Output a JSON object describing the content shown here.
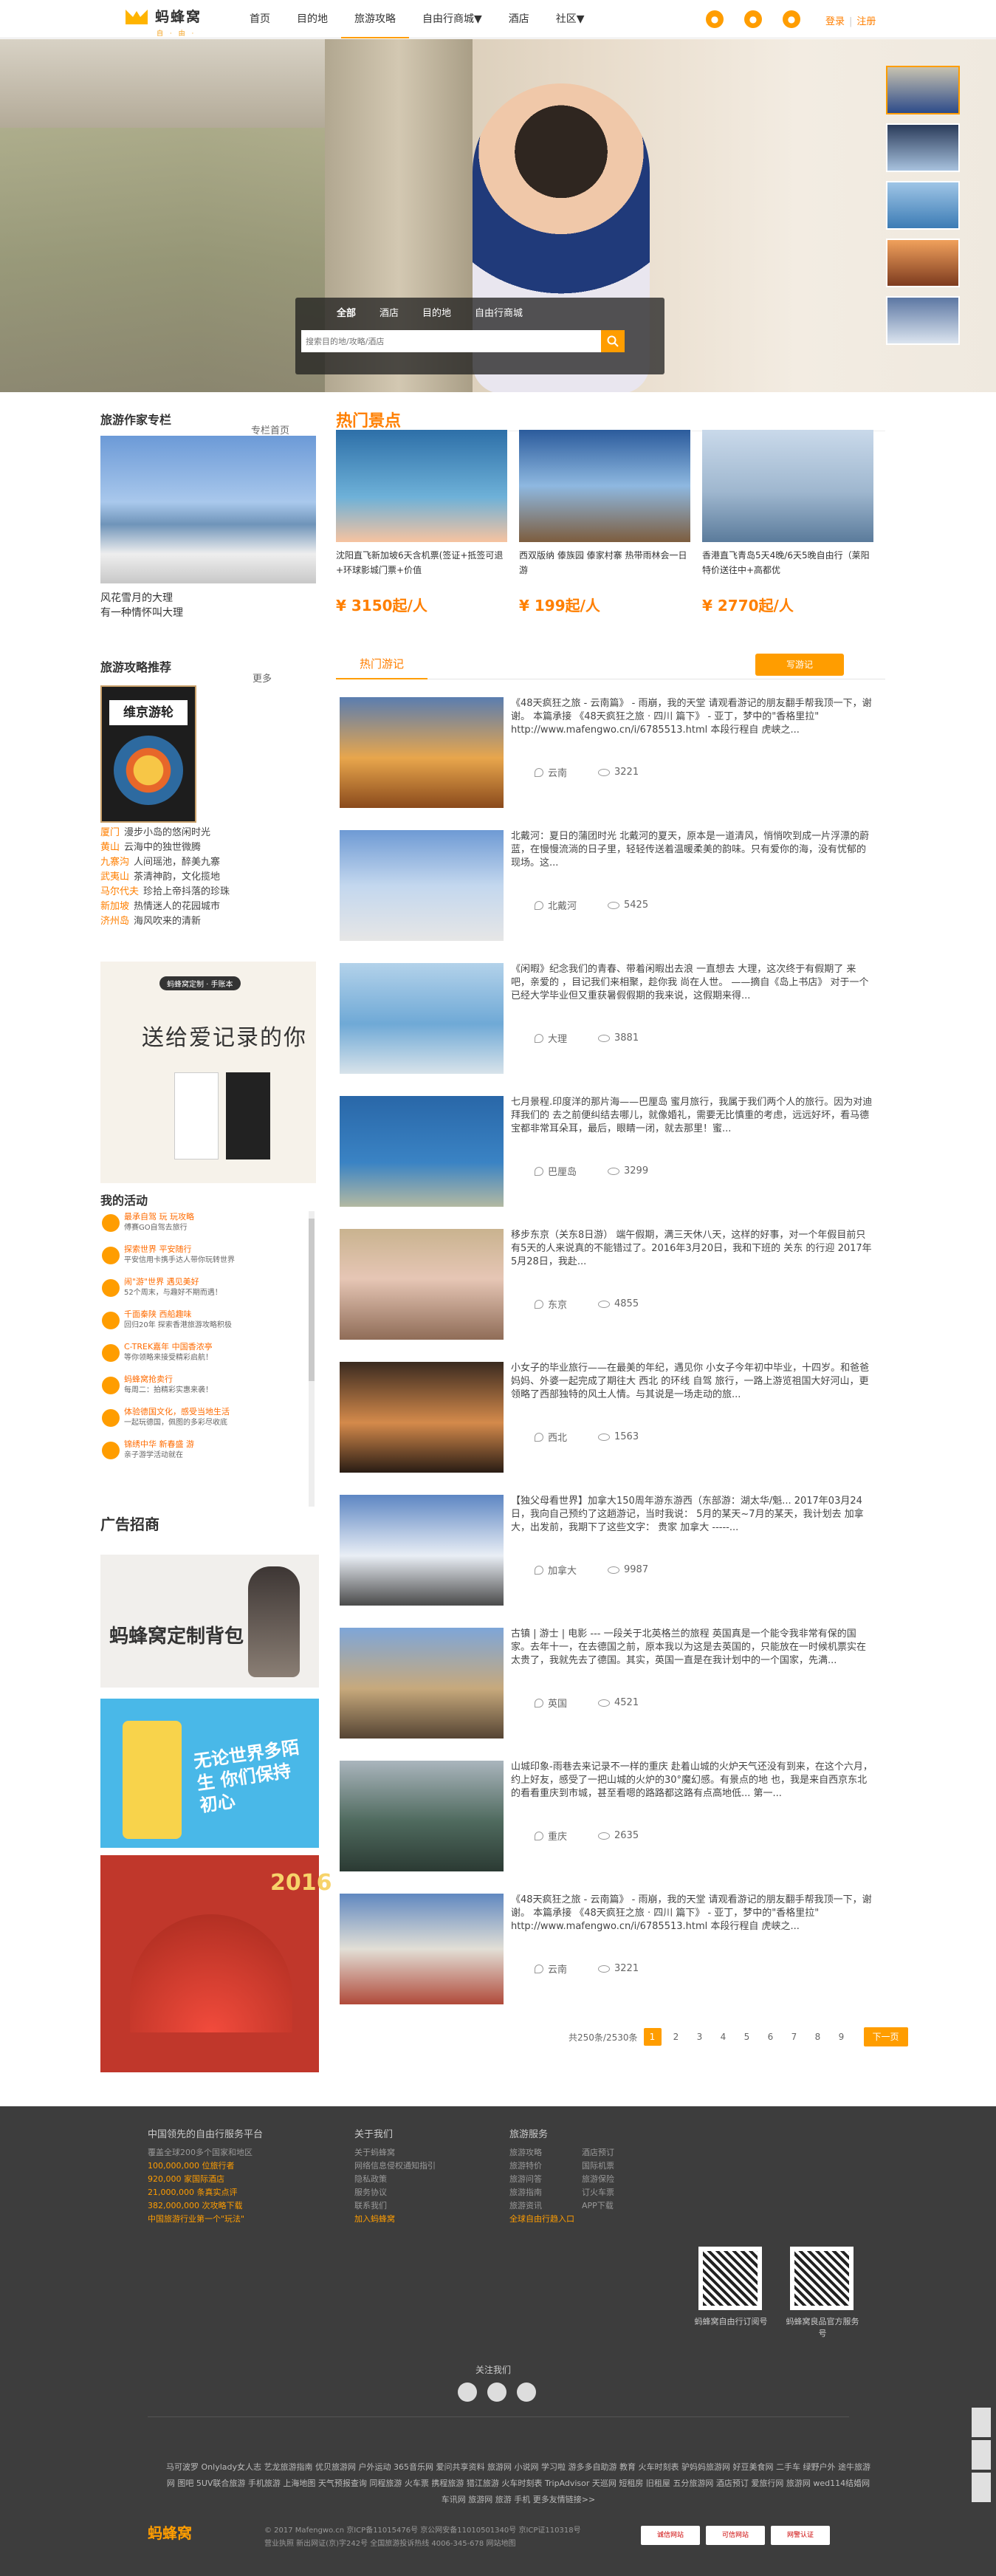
{
  "header": {
    "brand": "蚂蜂窝",
    "brand_sub": "自 · 由 · 行",
    "nav": [
      "首页",
      "目的地",
      "旅游攻略",
      "自由行商城▼",
      "酒店",
      "社区▼"
    ],
    "login": "登录",
    "register": "注册"
  },
  "search": {
    "tabs": [
      "全部",
      "酒店",
      "目的地",
      "自由行商城"
    ],
    "placeholder": "搜索目的地/攻略/酒店"
  },
  "columnist": {
    "title": "旅游作家专栏",
    "more": "专栏首页",
    "caption_1": "风花雪月的大理",
    "caption_2": "有一种情怀叫大理"
  },
  "guides": {
    "title": "旅游攻略推荐",
    "more": "更多",
    "book_title": "维京游轮",
    "items": [
      {
        "k": "厦门",
        "v": "漫步小岛的悠闲时光"
      },
      {
        "k": "黄山",
        "v": "云海中的独世微腾"
      },
      {
        "k": "九寨沟",
        "v": "人间瑶池，醉美九寨"
      },
      {
        "k": "武夷山",
        "v": "茶清神韵，文化揽地"
      },
      {
        "k": "马尔代夫",
        "v": "珍拾上帝抖落的珍珠"
      },
      {
        "k": "新加坡",
        "v": "热情迷人的花园城市"
      },
      {
        "k": "济州岛",
        "v": "海风吹来的清新"
      }
    ]
  },
  "promo": {
    "tag": "蚂蜂窝定制 · 手账本",
    "headline": "送给爱记录的你"
  },
  "activities": {
    "title": "我的活动",
    "items": [
      {
        "t": "最承自驾 玩 玩攻略",
        "s": "傅赛GO自驾去旅行"
      },
      {
        "t": "探索世界 平安随行",
        "s": "平安信用卡携手达人带你玩转世界"
      },
      {
        "t": "闹\"游\"世界 遇见美好",
        "s": "52个周末，与趣好不期而遇！"
      },
      {
        "t": "千面秦陕 西船趣味",
        "s": "回归20年 探索香港旅游攻略积极"
      },
      {
        "t": "C-TREK嘉年 中国香浓亭",
        "s": "等你领略来接受精彩启航！"
      },
      {
        "t": "蚂蜂窝抢卖行",
        "s": "每周二：拍精彩实惠来袭！"
      },
      {
        "t": "体验德国文化，感受当地生活",
        "s": "一起玩德国，佩图的多彩尽收底"
      },
      {
        "t": "锦绣中华 新春盛 游",
        "s": "亲子游学活动就在"
      }
    ]
  },
  "ads": {
    "title": "广告招商",
    "bag_text": "蚂蜂窝定制背包",
    "luggage_text": "无论世界多陌生 你们保持初心",
    "year": "2016"
  },
  "hot": {
    "title": "热门景点",
    "spots": [
      {
        "desc": "沈阳直飞新加坡6天含机票(签证+抵签可退+环球影城门票+价值",
        "price": "¥ 3150起/人"
      },
      {
        "desc": "西双版纳 傣族园 傣家村寨 热带雨林会一日游",
        "price": "¥ 199起/人"
      },
      {
        "desc": "香港直飞青岛5天4晚/6天5晚自由行（莱阳特价送往中+高都优",
        "price": "¥ 2770起/人"
      }
    ]
  },
  "notes": {
    "tab": "热门游记",
    "write": "写游记",
    "items": [
      {
        "text": "《48天疯狂之旅 - 云南篇》 - 雨崩，我的天堂 请观看游记的朋友翻手帮我顶一下，谢谢。 本篇承接 《48天疯狂之旅 · 四川 篇下》 - 亚丁，梦中的\"香格里拉\" http://www.mafengwo.cn/i/6785513.html 本段行程自 虎峡之...",
        "loc": "云南",
        "views": "3221"
      },
      {
        "text": "北戴河：夏日的蒲团时光 北戴河的夏天，原本是一道清风，悄悄吹到成一片浮漂的蔚蓝，在慢慢流淌的日子里，轻轻传送着温暖柔美的韵味。只有爱你的海，没有忧郁的现场。这...",
        "loc": "北戴河",
        "views": "5425"
      },
      {
        "text": "《闲暇》纪念我们的青春、带着闲暇出去浪 一直想去 大理，这次终于有假期了 来吧，亲爱的 ，目记我们来相聚，趁你我 尚在人世。 ——摘自《岛上书店》 对于一个已经大学毕业但又重获暑假假期的我来说，这假期来得...",
        "loc": "大理",
        "views": "3881"
      },
      {
        "text": "七月景程.印度洋的那片海——巴厘岛 蜜月旅行，我属于我们两个人的旅行。因为对迪拜我们的 去之前便纠结去哪儿，就像婚礼，需要无比慎重的考虑，远远好坏，看马德宝都非常耳朵耳，最后，眼睛一闭，就去那里！蜜...",
        "loc": "巴厘岛",
        "views": "3299"
      },
      {
        "text": "移步东京（关东8日游） 端午假期，满三天休八天，这样的好事，对一个年假目前只有5天的人来说真的不能错过了。2016年3月20日，我和下班的 关东 的行迎 2017年5月28日，我赴...",
        "loc": "东京",
        "views": "4855"
      },
      {
        "text": "小女子的毕业旅行——在最美的年纪，遇见你 小女子今年初中毕业，十四岁。和爸爸妈妈、外婆一起完成了期往大 西北 的环线 自驾 旅行，一路上游览祖国大好河山，更领略了西部独特的风土人情。与其说是一场走动的旅... ",
        "loc": "西北",
        "views": "1563"
      },
      {
        "text": "【独父母看世界】加拿大150周年游东游西（东部游：湖太华/魁... 2017年03月24日，我向自己预约了这趟游记，当时我说： 5月的某天~7月的某天，我计划去 加拿大，出发前，我期下了这些文字： 贵家 加拿大 -----...",
        "loc": "加拿大",
        "views": "9987"
      },
      {
        "text": "古镇 | 游士 | 电影 --- 一段关于北英格兰的旅程 英国真是一个能令我非常有保的国家。去年十一，在去德国之前，原本我以为这是去英国的，只能放在一时候机票实在太贵了，我就先去了德国。其实，英国一直是在我计划中的一个国家，先满...",
        "loc": "英国",
        "views": "4521"
      },
      {
        "text": "山城印象-雨巷去来记录不一样的重庆 赴着山城的火炉天气还没有到来，在这个六月，约上好友，感受了一把山城的火炉的30°魔幻感。有景点的地 也，我是来自西京东北的看看重庆到市城，甚至看嗯的路路都这路有点高地低... 第一...",
        "loc": "重庆",
        "views": "2635"
      },
      {
        "text": "《48天疯狂之旅 - 云南篇》 - 雨崩，我的天堂 请观看游记的朋友翻手帮我顶一下，谢谢。 本篇承接 《48天疯狂之旅 · 四川 篇下》 - 亚丁，梦中的\"香格里拉\" http://www.mafengwo.cn/i/6785513.html 本段行程自 虎峡之...",
        "loc": "云南",
        "views": "3221"
      }
    ]
  },
  "pager": {
    "total": "共250条/2530条",
    "pages": [
      "1",
      "2",
      "3",
      "4",
      "5",
      "6",
      "7",
      "8",
      "9"
    ],
    "next": "下一页"
  },
  "footer": {
    "about_title": "中国领先的自由行服务平台",
    "about_lines": [
      "覆盖全球200多个国家和地区",
      "100,000,000 位旅行者",
      "920,000 家国际酒店",
      "21,000,000 条真实点评",
      "382,000,000 次攻略下载",
      "中国旅游行业第一个\"玩法\""
    ],
    "us_title": "关于我们",
    "us_links": [
      "关于蚂蜂窝",
      "网络信息侵权通知指引",
      "隐私政策",
      "服务协议",
      "联系我们",
      "加入蚂蜂窝"
    ],
    "svc_title": "旅游服务",
    "svc_links_a": [
      "旅游攻略",
      "旅游特价",
      "旅游问答",
      "旅游指南",
      "旅游资讯",
      "全球自由行趋入口"
    ],
    "svc_links_b": [
      "酒店预订",
      "国际机票",
      "旅游保险",
      "订火车票",
      "APP下载"
    ],
    "qr1": "蚂蜂窝自由行订阅号",
    "qr2": "蚂蜂窝良品官方服务号",
    "follow": "关注我们",
    "links": "马可波罗 Onlylady女人志 艺龙旅游指南 优贝旅游网 户外运动 365音乐网 爱问共享资料 旅游网 小说网 学习啦 游多多自助游 教育 火车时刻表 驴妈妈旅游网 好豆美食网 二手车 绿野户外 途牛旅游网 图吧 5UV联合旅游 手机旅游 上海地图 天气预报查询 同程旅游 火车票 携程旅游 猎江旅游 火车时刻表 TripAdvisor 天巡网 短租房 旧租屋 五分旅游网 酒店预订 爱旅行网 旅游网 wed114结婚网 车讯网 旅游网 旅游 手机 更多友情链接>>",
    "brand": "蚂蜂窝",
    "copy_1": "© 2017 Mafengwo.cn 京ICP备11015476号 京公网安备11010501340号 京ICP证110318号",
    "copy_2": "营业执照 新出网证(京)字242号 全国旅游投诉热线 4006-345-678 网站地图",
    "badges": [
      "诚信网站",
      "可信网站",
      "网警认证"
    ]
  }
}
